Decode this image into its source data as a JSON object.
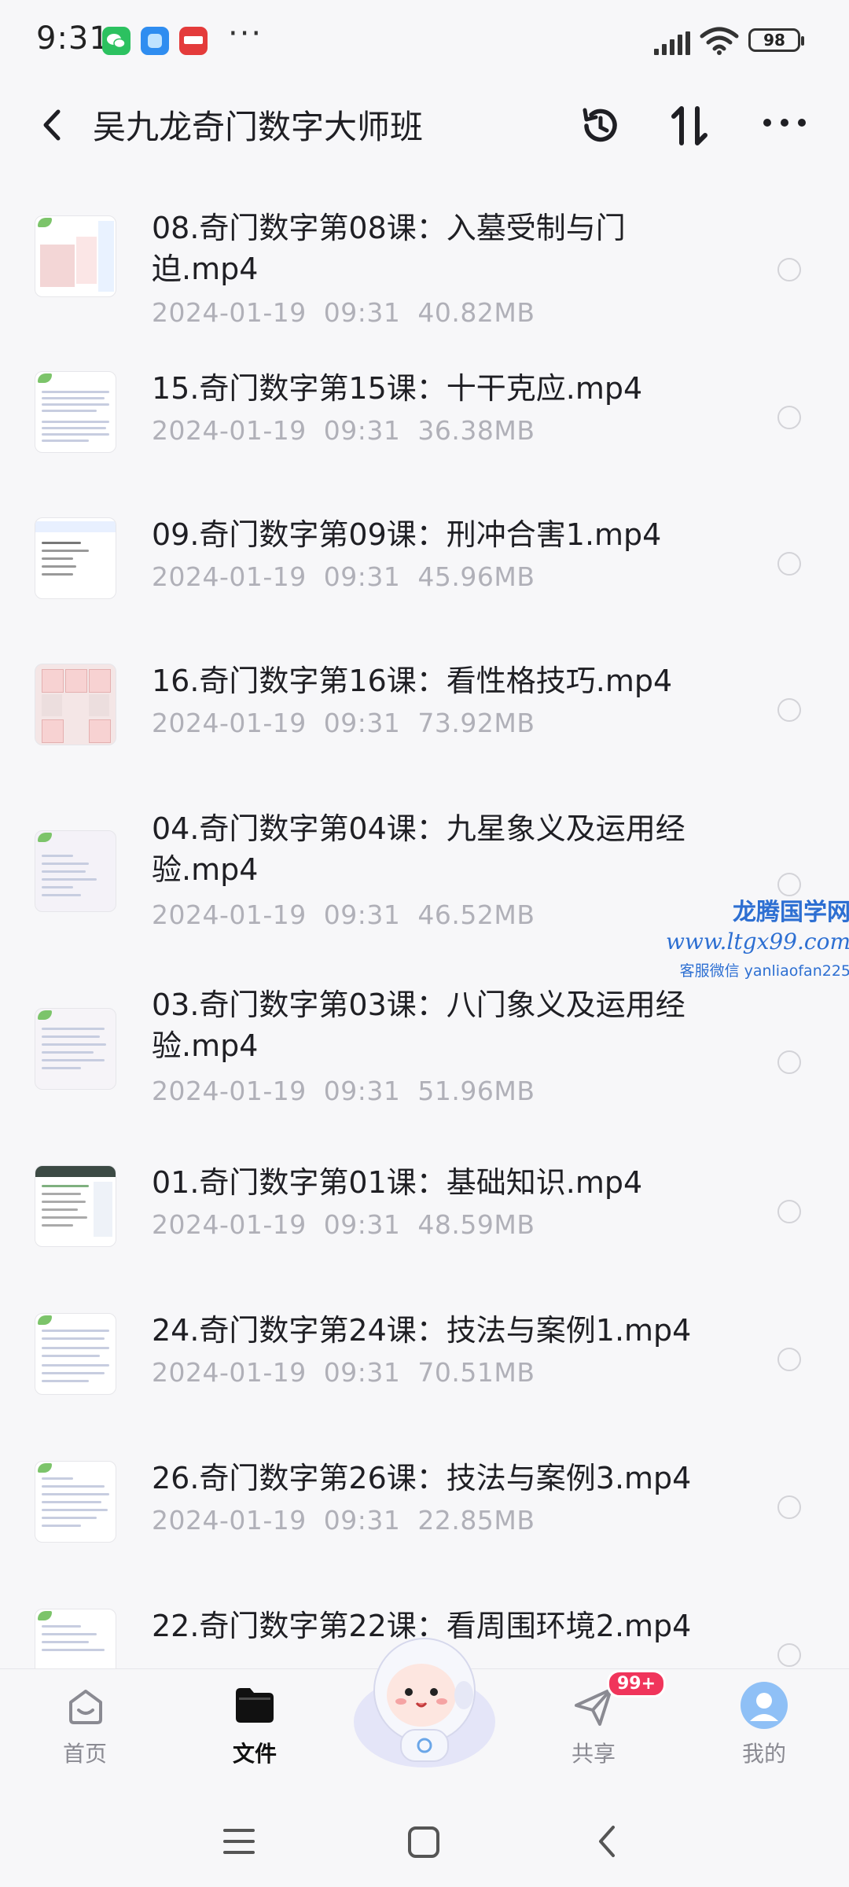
{
  "status_bar": {
    "time": "9:31",
    "battery": "98",
    "app_icons": [
      "wechat-icon",
      "blue-app-icon",
      "kandian-icon"
    ],
    "more": "···"
  },
  "header": {
    "title": "吴九龙奇门数字大师班",
    "icons": [
      "back-icon",
      "history-icon",
      "sort-icon",
      "more-icon"
    ]
  },
  "files": [
    {
      "name": "08.奇门数字第08课：入墓受制与门迫.mp4",
      "date": "2024-01-19",
      "time": "09:31",
      "size": "40.82MB"
    },
    {
      "name": "15.奇门数字第15课：十干克应.mp4",
      "date": "2024-01-19",
      "time": "09:31",
      "size": "36.38MB"
    },
    {
      "name": "09.奇门数字第09课：刑冲合害1.mp4",
      "date": "2024-01-19",
      "time": "09:31",
      "size": "45.96MB"
    },
    {
      "name": "16.奇门数字第16课：看性格技巧.mp4",
      "date": "2024-01-19",
      "time": "09:31",
      "size": "73.92MB"
    },
    {
      "name": "04.奇门数字第04课：九星象义及运用经验.mp4",
      "date": "2024-01-19",
      "time": "09:31",
      "size": "46.52MB"
    },
    {
      "name": "03.奇门数字第03课：八门象义及运用经验.mp4",
      "date": "2024-01-19",
      "time": "09:31",
      "size": "51.96MB"
    },
    {
      "name": "01.奇门数字第01课：基础知识.mp4",
      "date": "2024-01-19",
      "time": "09:31",
      "size": "48.59MB"
    },
    {
      "name": "24.奇门数字第24课：技法与案例1.mp4",
      "date": "2024-01-19",
      "time": "09:31",
      "size": "70.51MB"
    },
    {
      "name": "26.奇门数字第26课：技法与案例3.mp4",
      "date": "2024-01-19",
      "time": "09:31",
      "size": "22.85MB"
    },
    {
      "name": "22.奇门数字第22课：看周围环境2.mp4",
      "date": "",
      "time": "",
      "size": ""
    }
  ],
  "watermark": {
    "line1": "龙腾国学网",
    "line2": "www.ltgx99.com",
    "line3": "客服微信 yanliaofan225"
  },
  "tabbar": {
    "tabs": [
      {
        "label": "首页",
        "icon": "home-icon"
      },
      {
        "label": "文件",
        "icon": "folder-icon",
        "active": true
      },
      {
        "label": "共享",
        "icon": "share-icon"
      },
      {
        "label": "我的",
        "icon": "profile-icon"
      }
    ],
    "share_badge": "99+",
    "mascot": "mascot-icon"
  },
  "navbar": {
    "icons": [
      "menu-icon",
      "home-square-icon",
      "back-nav-icon"
    ]
  },
  "colors": {
    "background": "#f7f7f9",
    "badge": "#f0355b",
    "watermark": "#2d6fd2",
    "meta_text": "#b0b0b8"
  }
}
